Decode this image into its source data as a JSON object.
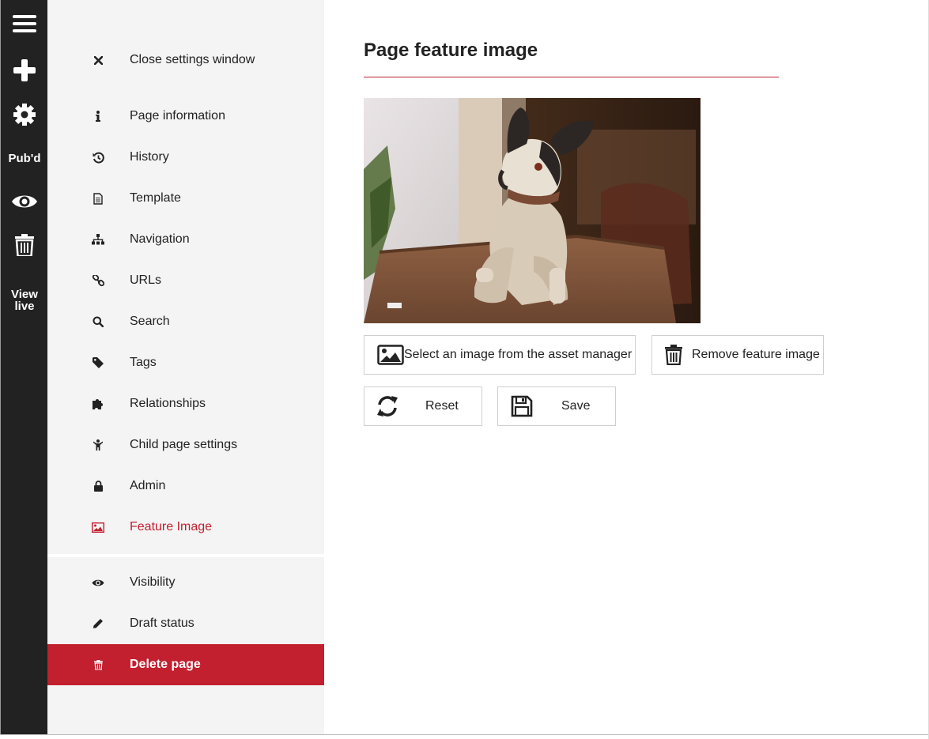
{
  "toolbar": {
    "menu_icon": "hamburger-icon",
    "add_icon": "plus-icon",
    "settings_icon": "gear-icon",
    "status_label": "Pub'd",
    "preview_icon": "eye-icon",
    "delete_icon": "trash-icon",
    "view_live_line1": "View",
    "view_live_line2": "live"
  },
  "settings": {
    "close_label": "Close settings window",
    "items": [
      {
        "label": "Page information",
        "icon": "info-icon"
      },
      {
        "label": "History",
        "icon": "history-icon"
      },
      {
        "label": "Template",
        "icon": "document-icon"
      },
      {
        "label": "Navigation",
        "icon": "sitemap-icon"
      },
      {
        "label": "URLs",
        "icon": "link-icon"
      },
      {
        "label": "Search",
        "icon": "search-icon"
      },
      {
        "label": "Tags",
        "icon": "tag-icon"
      },
      {
        "label": "Relationships",
        "icon": "puzzle-icon"
      },
      {
        "label": "Child page settings",
        "icon": "child-icon"
      },
      {
        "label": "Admin",
        "icon": "lock-icon"
      },
      {
        "label": "Feature Image",
        "icon": "image-icon",
        "active": true
      }
    ],
    "secondary": [
      {
        "label": "Visibility",
        "icon": "eye-icon"
      },
      {
        "label": "Draft status",
        "icon": "pencil-icon"
      },
      {
        "label": "Delete page",
        "icon": "trash-icon"
      }
    ]
  },
  "main": {
    "title": "Page feature image",
    "buttons": {
      "select_image": "Select an image from the asset manager",
      "remove_image": "Remove feature image",
      "reset": "Reset",
      "save": "Save"
    }
  },
  "colors": {
    "accent": "#c21f2f",
    "toolbar_bg": "#222222",
    "panel_bg": "#f4f4f4"
  }
}
